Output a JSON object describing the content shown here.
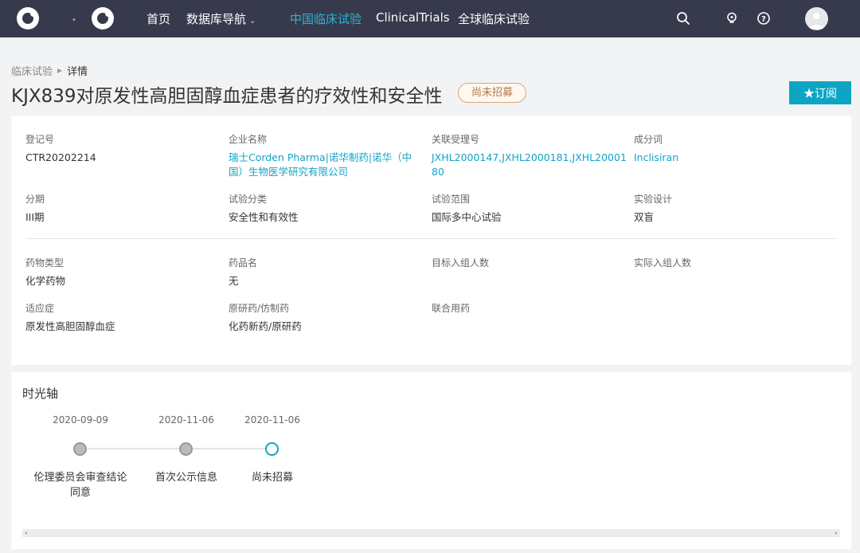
{
  "nav": {
    "items": [
      "首页",
      "数据库导航",
      "中国临床试验",
      "ClinicalTrials",
      "全球临床试验"
    ],
    "caret": "⌄"
  },
  "breadcrumb": {
    "parent": "临床试验",
    "current": "详情"
  },
  "title": "KJX839对原发性高胆固醇血症患者的疗效性和安全性",
  "status_badge": "尚未招募",
  "subscribe_label": "★订阅",
  "fields": {
    "reg_no": {
      "label": "登记号",
      "value": "CTR20202214"
    },
    "company": {
      "label": "企业名称",
      "value": "瑞士Corden Pharma|诺华制药|诺华（中国）生物医学研究有限公司"
    },
    "accept_no": {
      "label": "关联受理号",
      "value": "JXHL2000147,JXHL2000181,JXHL2000180"
    },
    "ingredient": {
      "label": "成分词",
      "value": "Inclisiran"
    },
    "phase": {
      "label": "分期",
      "value": "III期"
    },
    "category": {
      "label": "试验分类",
      "value": "安全性和有效性"
    },
    "scope": {
      "label": "试验范围",
      "value": "国际多中心试验"
    },
    "design": {
      "label": "实验设计",
      "value": "双盲"
    },
    "drug_type": {
      "label": "药物类型",
      "value": "化学药物"
    },
    "drug_name": {
      "label": "药品名",
      "value": "无"
    },
    "target_enroll": {
      "label": "目标入组人数",
      "value": ""
    },
    "actual_enroll": {
      "label": "实际入组人数",
      "value": ""
    },
    "indication": {
      "label": "适应症",
      "value": "原发性高胆固醇血症"
    },
    "orig_generic": {
      "label": "原研药/仿制药",
      "value": "化药新药/原研药"
    },
    "combo": {
      "label": "联合用药",
      "value": ""
    }
  },
  "timeline": {
    "title": "时光轴",
    "events": [
      {
        "date": "2020-09-09",
        "label": "伦理委员会审查结论同意"
      },
      {
        "date": "2020-11-06",
        "label": "首次公示信息"
      },
      {
        "date": "2020-11-06",
        "label": "尚未招募"
      }
    ]
  },
  "colors": {
    "nav_bg": "#363a4c",
    "accent": "#14a3c7",
    "badge": "#b07a48"
  },
  "icons": [
    "logo-icon",
    "search-icon",
    "bulb-icon",
    "help-icon",
    "user-avatar-icon"
  ]
}
